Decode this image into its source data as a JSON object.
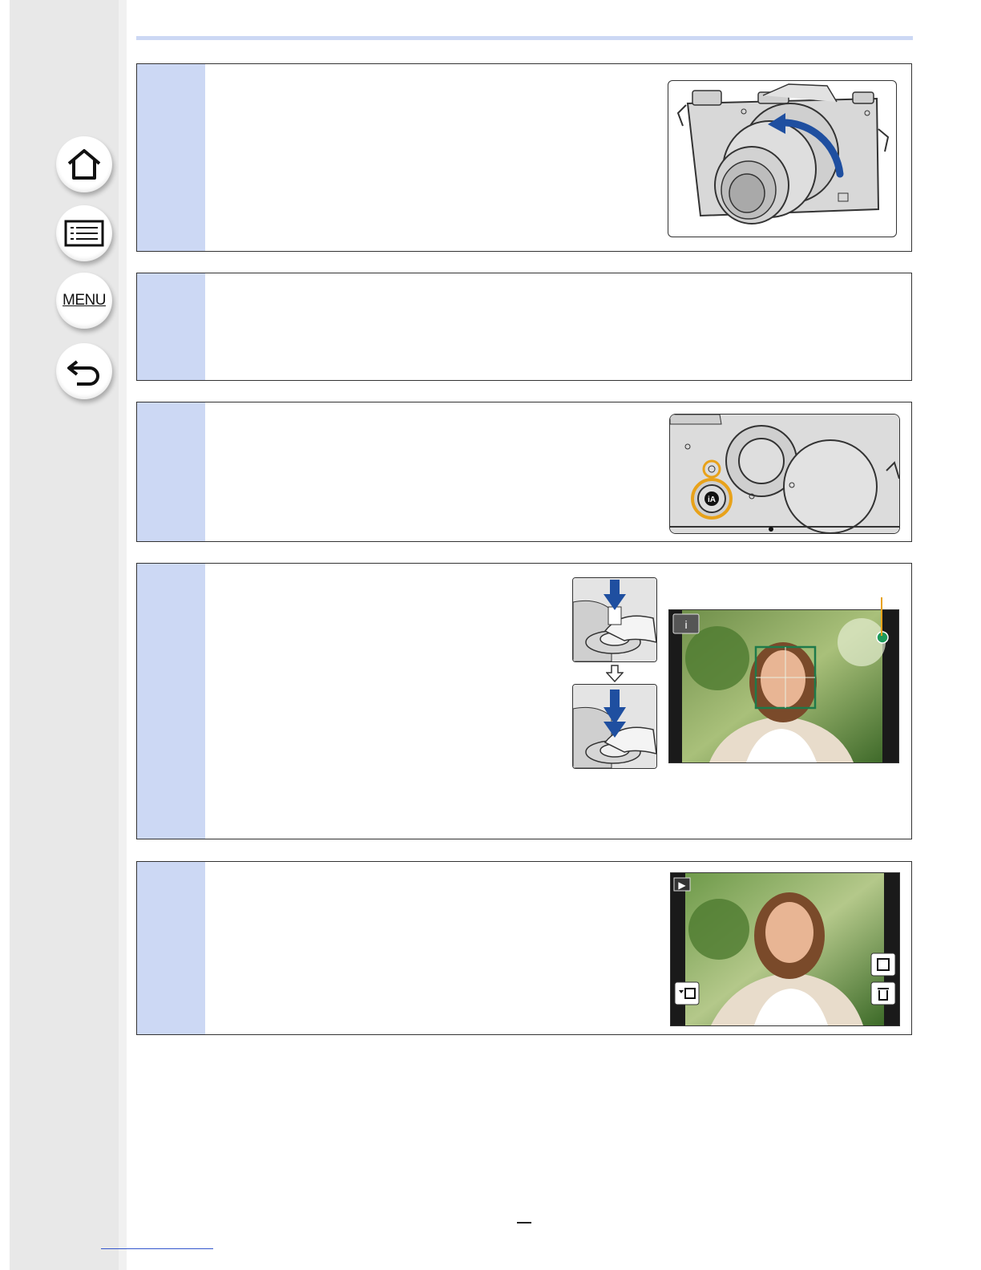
{
  "sidebar": {
    "buttons": [
      {
        "name": "home",
        "icon": "home-icon"
      },
      {
        "name": "contents",
        "icon": "list-icon"
      },
      {
        "name": "menu",
        "label": "MENU"
      },
      {
        "name": "back",
        "icon": "return-arrow-icon"
      }
    ]
  },
  "colors": {
    "accent_band": "#ccd8f4",
    "sidebar": "#e8e8e8",
    "arrow_blue": "#1f4fa0",
    "highlight_orange": "#e8a21a",
    "focus_green": "#1e7a4a"
  },
  "steps": [
    {
      "id": 1,
      "illustration": "camera-lens-rotate-icon"
    },
    {
      "id": 2
    },
    {
      "id": 3,
      "illustration": "ia-button-top-view-icon"
    },
    {
      "id": 4,
      "illustration": "shutter-half-press-and-focus-screen-icon"
    },
    {
      "id": 5,
      "illustration": "playback-screen-icon"
    }
  ],
  "screens": {
    "record_mode_icon": "i",
    "playback_icon": "▶"
  }
}
